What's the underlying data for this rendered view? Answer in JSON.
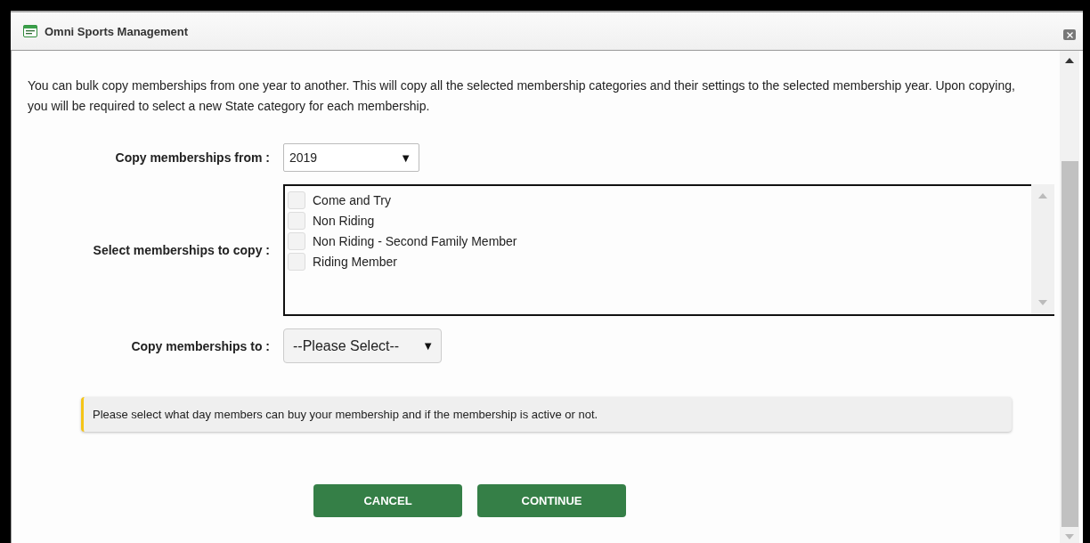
{
  "window": {
    "title": "Omni Sports Management"
  },
  "intro": "You can bulk copy memberships from one year to another. This will copy all the selected membership categories and their settings to the selected membership year. Upon copying, you will be required to select a new State category for each membership.",
  "copy_from": {
    "label": "Copy memberships from :",
    "value": "2019"
  },
  "memberships": {
    "label": "Select memberships to copy :",
    "items": [
      {
        "name": "Come and Try",
        "checked": false
      },
      {
        "name": "Non Riding",
        "checked": false
      },
      {
        "name": "Non Riding - Second Family Member",
        "checked": false
      },
      {
        "name": "Riding Member",
        "checked": false
      }
    ]
  },
  "copy_to": {
    "label": "Copy memberships to :",
    "value": "--Please Select--"
  },
  "note": "Please select what day members can buy your membership and if the membership is active or not.",
  "buttons": [
    {
      "label": "CANCEL"
    },
    {
      "label": "CONTINUE"
    }
  ],
  "dropdown_arrow": "▼"
}
